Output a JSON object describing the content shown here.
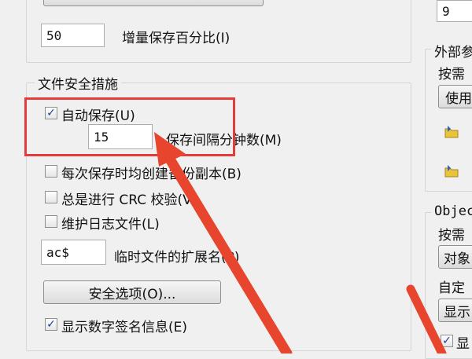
{
  "top_value": "9",
  "incremental": {
    "value": "50",
    "label": "增量保存百分比(I)"
  },
  "file_safety": {
    "legend": "文件安全措施",
    "autosave": {
      "label": "自动保存(U)",
      "checked": true
    },
    "interval": {
      "value": "15",
      "label": "保存间隔分钟数(M)"
    },
    "backup": {
      "label": "每次保存时均创建备份副本(B)",
      "checked": false
    },
    "crc": {
      "label": "总是进行 CRC 校验(V)",
      "checked": false
    },
    "log": {
      "label": "维护日志文件(L)",
      "checked": false
    },
    "temp_ext": {
      "value": "ac$",
      "label": "临时文件的扩展名(P)"
    },
    "security_button": "安全选项(O)...",
    "digital_sig": {
      "label": "显示数字签名信息(E)",
      "checked": true
    }
  },
  "right_panel": {
    "external_legend": "外部参",
    "external_load_label": "按需",
    "external_select": "使用",
    "objectarx_legend": "Objec",
    "objectarx_load_label": "按需",
    "objectarx_select": "对象",
    "custom_label": "自定",
    "display_button": "显示",
    "bottom_checkbox_label": "显"
  },
  "colors": {
    "highlight": "#e43b3b",
    "arrow": "#e8452f"
  }
}
